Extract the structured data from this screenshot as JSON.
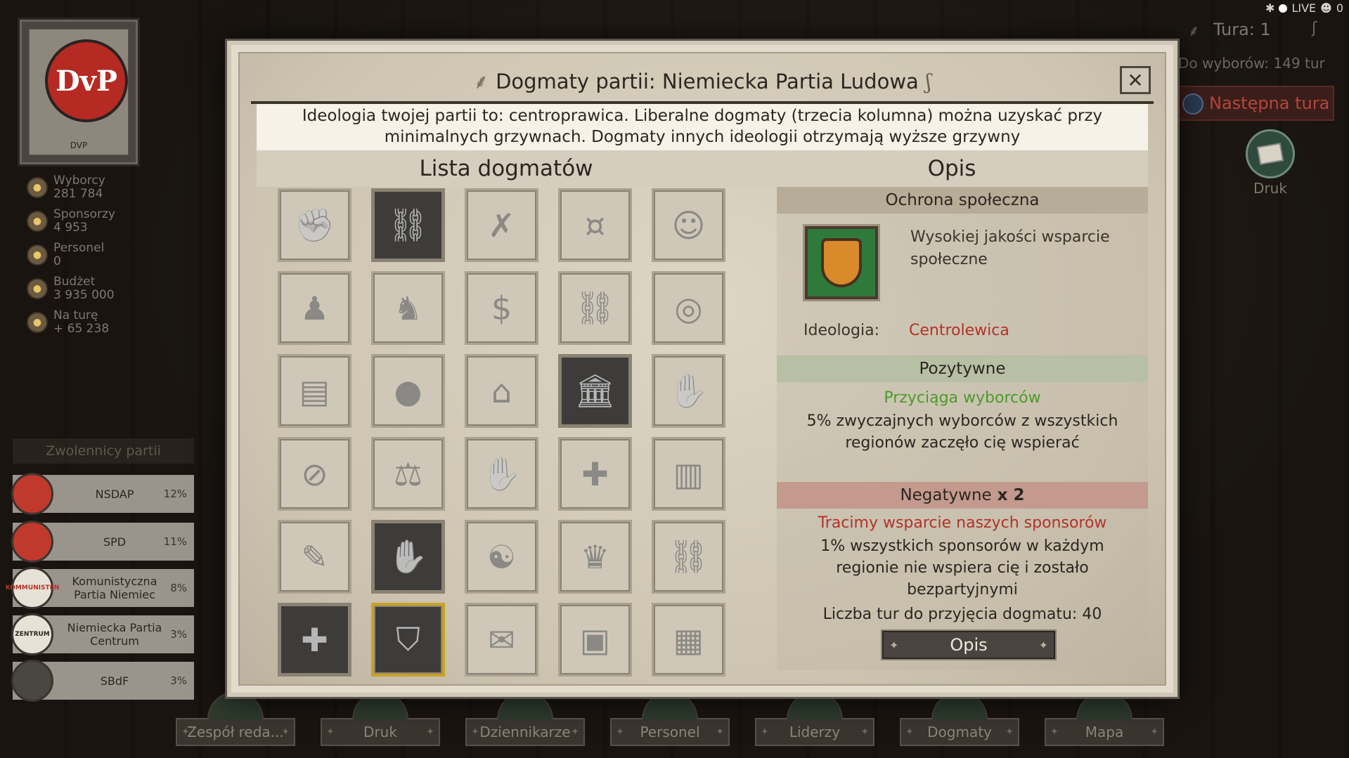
{
  "top_right": {
    "live_label": "LIVE",
    "viewers": "0",
    "tura_label": "Tura: 1",
    "wybory_label": "Do wyborów: 149 tur",
    "next_turn_label": "Następna tura",
    "druk_label": "Druk"
  },
  "party_card": {
    "abbrev": "DVP",
    "logo_text": "DvP"
  },
  "stats": [
    {
      "label": "Wyborcy",
      "value": "281 784",
      "icon": "voters-icon"
    },
    {
      "label": "Sponsorzy",
      "value": "4 953",
      "icon": "sponsors-icon"
    },
    {
      "label": "Personel",
      "value": "0",
      "icon": "personnel-icon"
    },
    {
      "label": "Budżet",
      "value": "3 935 000",
      "icon": "budget-icon"
    },
    {
      "label": "Na turę",
      "value": "+ 65 238",
      "icon": "per-turn-icon"
    }
  ],
  "supporters_title": "Zwolennicy partii",
  "parties": [
    {
      "name": "NSDAP",
      "pct": "12%",
      "color": "#c0392b"
    },
    {
      "name": "SPD",
      "pct": "11%",
      "color": "#c0392b"
    },
    {
      "name": "Komunistyczna Partia Niemiec",
      "pct": "8%",
      "color": "#e8e2d6",
      "logo_text": "KOMMUNISTEN"
    },
    {
      "name": "Niemiecka Partia Centrum",
      "pct": "3%",
      "color": "#e8e2d6",
      "logo_text": "ZENTRUM"
    },
    {
      "name": "SBdF",
      "pct": "3%",
      "color": "#4a4642"
    }
  ],
  "bottom_nav": [
    "Zespół reda...",
    "Druk",
    "Dziennikarze",
    "Personel",
    "Liderzy",
    "Dogmaty",
    "Mapa"
  ],
  "dialog": {
    "title": "Dogmaty partii: Niemiecka Partia Ludowa",
    "info": "Ideologia twojej partii to: centroprawica. Liberalne dogmaty (trzecia kolumna) można uzyskać przy minimalnych grzywnach. Dogmaty innych ideologii otrzymają wyższe grzywny",
    "list_header": "Lista dogmatów",
    "opis_header": "Opis",
    "close_icon": "close-icon"
  },
  "dogma_tiles": [
    {
      "icon": "raised-fist-icon",
      "glyph": "✊",
      "state": "normal"
    },
    {
      "icon": "broken-chain-icon",
      "glyph": "⛓",
      "state": "dark"
    },
    {
      "icon": "crossed-out-man-icon",
      "glyph": "✗",
      "state": "normal"
    },
    {
      "icon": "coin-stacks-icon",
      "glyph": "¤",
      "state": "normal"
    },
    {
      "icon": "portrait-icon",
      "glyph": "☺",
      "state": "normal"
    },
    {
      "icon": "capitalists-icon",
      "glyph": "♟",
      "state": "normal"
    },
    {
      "icon": "capitalist-handshake-icon",
      "glyph": "♞",
      "state": "normal"
    },
    {
      "icon": "banknotes-icon",
      "glyph": "$",
      "state": "normal"
    },
    {
      "icon": "chained-document-icon",
      "glyph": "⛓",
      "state": "normal"
    },
    {
      "icon": "hand-globe-icon",
      "glyph": "◎",
      "state": "normal"
    },
    {
      "icon": "desk-icon",
      "glyph": "▤",
      "state": "normal"
    },
    {
      "icon": "ball-and-chain-icon",
      "glyph": "●",
      "state": "normal"
    },
    {
      "icon": "house-icon",
      "glyph": "⌂",
      "state": "normal"
    },
    {
      "icon": "government-building-icon",
      "glyph": "🏛",
      "state": "dark"
    },
    {
      "icon": "hand-stamp-icon",
      "glyph": "✋",
      "state": "normal"
    },
    {
      "icon": "stop-sign-chain-icon",
      "glyph": "⊘",
      "state": "normal"
    },
    {
      "icon": "scales-icon",
      "glyph": "⚖",
      "state": "normal"
    },
    {
      "icon": "handshake-icon",
      "glyph": "✋",
      "state": "normal"
    },
    {
      "icon": "crossed-sign-chain-icon",
      "glyph": "✚",
      "state": "normal"
    },
    {
      "icon": "fence-icon",
      "glyph": "▥",
      "state": "normal"
    },
    {
      "icon": "hand-tool-icon",
      "glyph": "✎",
      "state": "normal"
    },
    {
      "icon": "linked-hands-icon",
      "glyph": "✋",
      "state": "dark"
    },
    {
      "icon": "religions-icon",
      "glyph": "☯",
      "state": "normal"
    },
    {
      "icon": "top-hat-man-icon",
      "glyph": "♛",
      "state": "normal"
    },
    {
      "icon": "shackle-icon",
      "glyph": "⛓",
      "state": "normal"
    },
    {
      "icon": "medical-cross-hand-icon",
      "glyph": "✚",
      "state": "dark"
    },
    {
      "icon": "shield-icon",
      "glyph": "⛉",
      "state": "selected"
    },
    {
      "icon": "scroll-icon",
      "glyph": "✉",
      "state": "normal"
    },
    {
      "icon": "stop-crate-icon",
      "glyph": "▣",
      "state": "normal"
    },
    {
      "icon": "prison-bars-icon",
      "glyph": "▦",
      "state": "normal"
    }
  ],
  "description": {
    "name": "Ochrona społeczna",
    "subtitle": "Wysokiej jakości wsparcie społeczne",
    "ideology_label": "Ideologia:",
    "ideology_value": "Centrolewica",
    "positive_header": "Pozytywne",
    "positive_title": "Przyciąga wyborców",
    "positive_text": "5% zwyczajnych wyborców z wszystkich regionów zaczęło cię wspierać",
    "negative_header": "Negatywne",
    "negative_multiplier": "x 2",
    "negative_title": "Tracimy wsparcie naszych sponsorów",
    "negative_text": "1% wszystkich sponsorów w każdym regionie nie wspiera cię i zostało bezpartyjnymi",
    "turns_text": "Liczba tur do przyjęcia dogmatu: 40",
    "opis_button": "Opis"
  },
  "colors": {
    "positive": "#4c9a2c",
    "negative": "#b23328",
    "selected_border": "#c9a227"
  }
}
